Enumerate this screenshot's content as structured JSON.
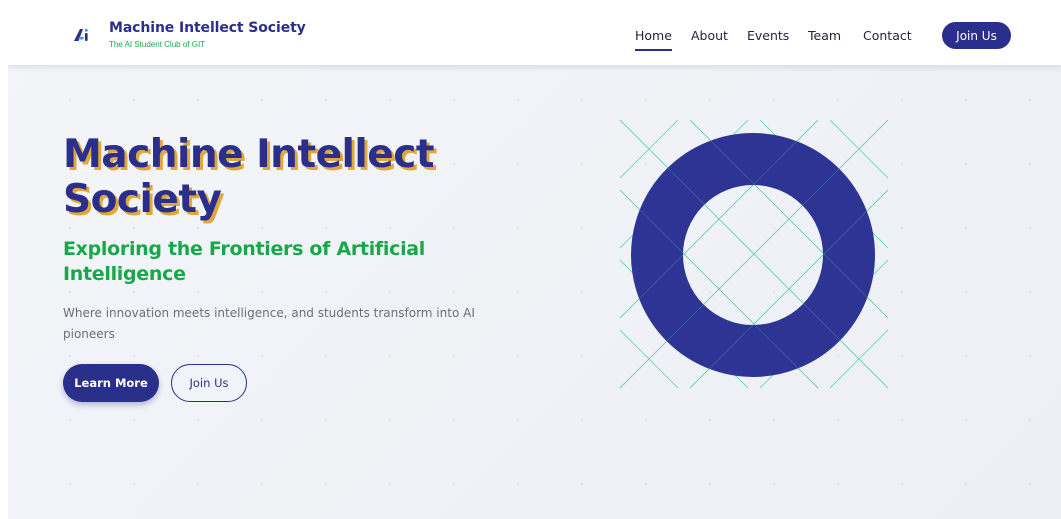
{
  "brand": {
    "title": "Machine Intellect Society",
    "subtitle": "The AI Student Club of GIT",
    "logo_icon": "ai-logo-icon"
  },
  "nav": {
    "items": [
      {
        "label": "Home",
        "active": true
      },
      {
        "label": "About",
        "active": false
      },
      {
        "label": "Events",
        "active": false
      },
      {
        "label": "Team",
        "active": false
      },
      {
        "label": "Contact",
        "active": false
      }
    ],
    "join_label": "Join Us"
  },
  "hero": {
    "title_line1": "Machine Intellect",
    "title_line2": "Society",
    "subtitle_line1": "Exploring the Frontiers of Artificial",
    "subtitle_line2": "Intelligence",
    "description_line1": "Where innovation meets intelligence, and students transform into AI",
    "description_line2": "pioneers",
    "primary_button": "Learn More",
    "secondary_button": "Join Us"
  },
  "colors": {
    "primary": "#2a2f8c",
    "accent_green": "#18a84a",
    "title_shadow": "#e0a83a",
    "graphic_lines": "#6fd6b6"
  }
}
